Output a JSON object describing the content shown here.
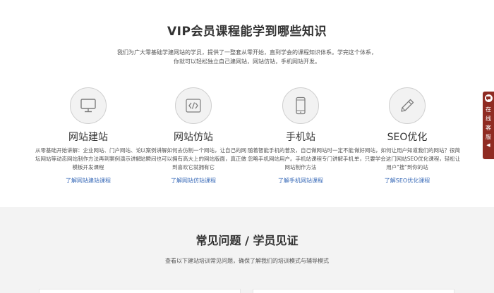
{
  "header": {
    "title": "VIP会员课程能学到哪些知识",
    "intro_line1": "我们为广大零基础学建网站的学员，提供了一整套从零开始，直到学会的课程知识体系。学完这个体系，",
    "intro_line2": "你就可以轻松独立自己建网站，网站仿站，手机网站开发。"
  },
  "features": [
    {
      "icon": "monitor-icon",
      "title": "网站建站",
      "desc": "从零基础开始讲解：企业网站、门户网站、论坛网站等动态网站制作方法再到案例演示讲解模板开发课程",
      "link": "了解网站建站课程"
    },
    {
      "icon": "code-icon",
      "title": "网站仿站",
      "desc": "以案例讲解如何去仿制一个网站，让自己的网站瞬间也可以拥有高大上的网站版面，真正做到喜欢它就拥有它",
      "link": "了解网站仿站课程"
    },
    {
      "icon": "mobile-icon",
      "title": "手机站",
      "desc": "随着智能手机的普及，自己做网站时一定不能忽略手机网站用户。手机站课程专门讲解手机网站制作方法",
      "link": "了解手机网站课程"
    },
    {
      "icon": "pencil-icon",
      "title": "SEO优化",
      "desc": "做好网站，如何让用户知道我们的网站？很简单，只要学会这门网站SEO优化课程，轻松让用户\"搜\"到你的站",
      "link": "了解SEO优化课程"
    }
  ],
  "faq": {
    "title": "常见问题 / 学员见证",
    "subtitle": "查看以下建站培训常见问题，确保了解我们的培训模式与辅导模式"
  },
  "sidebar": {
    "online_label": "在线客服",
    "accent": "#8f2b22"
  }
}
